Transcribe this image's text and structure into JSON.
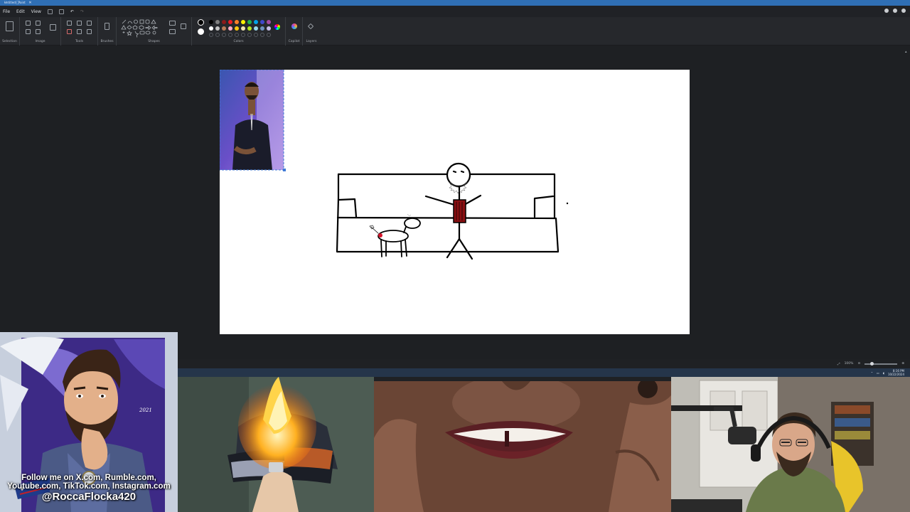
{
  "window": {
    "title": "Untitled - Paint",
    "controls": "–  □  ✕"
  },
  "menu": {
    "file": "File",
    "edit": "Edit",
    "view": "View"
  },
  "ribbon": {
    "groups": {
      "selection": "Selection",
      "image": "Image",
      "tools": "Tools",
      "brushes": "Brushes",
      "shapes": "Shapes",
      "colors": "Colors",
      "copilot": "Copilot",
      "layers": "Layers"
    },
    "palette": [
      "#000000",
      "#7f7f7f",
      "#8b1a1a",
      "#ed1c24",
      "#ff7f27",
      "#fff200",
      "#22b14c",
      "#00a2e8",
      "#3f48cc",
      "#a349a4",
      "#ffffff",
      "#c3c3c3",
      "#b97a57",
      "#ffaec9",
      "#ffc90e",
      "#efe4b0",
      "#b5e61d",
      "#99d9ea",
      "#7092be",
      "#c8bfe7"
    ]
  },
  "status": {
    "zoom": "100%"
  },
  "taskbar": {
    "time": "8:16 PM",
    "date": "10/22/2024"
  },
  "overlay": {
    "follow_line1": "Follow me on X.com, Rumble.com,",
    "follow_line2": "Youtube.com, TikTok.com, Instagram.com",
    "handle": "@RoccaFlocka420",
    "signature": "2021"
  },
  "colors": {
    "accent": "#2f6fb5",
    "canvas": "#ffffff",
    "workspace": "#1e2023"
  }
}
